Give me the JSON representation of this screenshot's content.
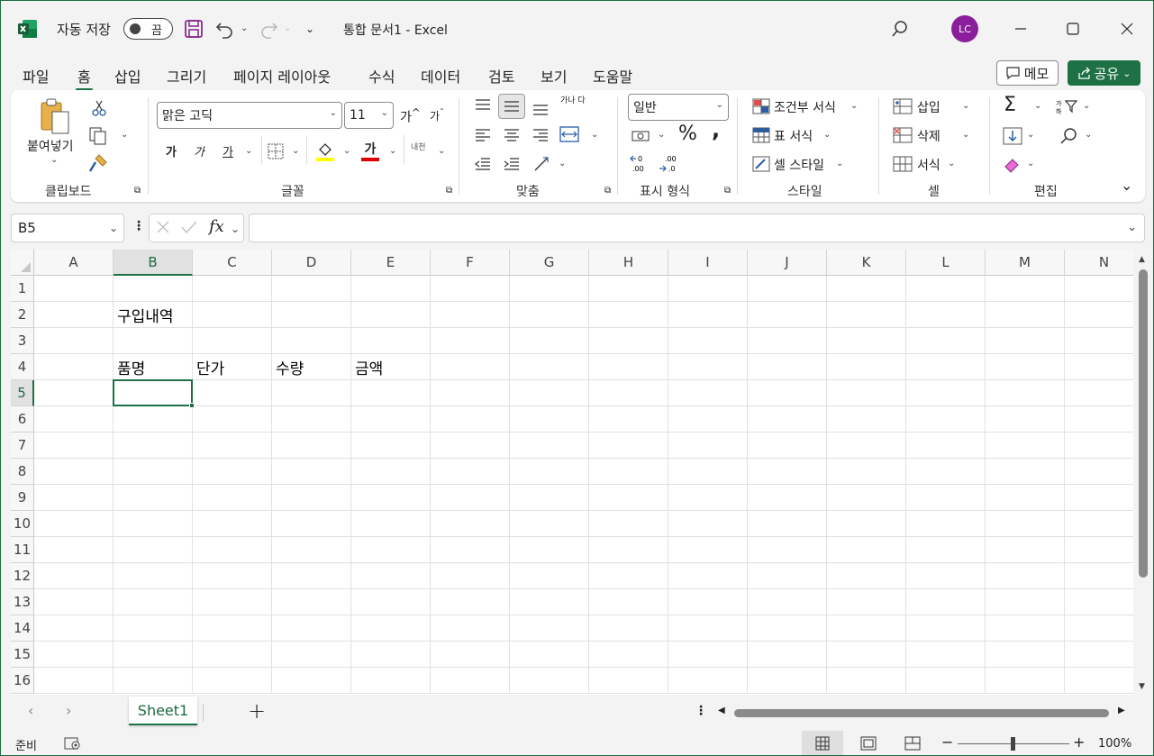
{
  "titlebar": {
    "app_icon": "excel-logo-icon",
    "autosave_label": "자동 저장",
    "autosave_state": "끔",
    "doc_title": "통합 문서1  -  Excel",
    "avatar_initials": "LC",
    "accent_color": "#1e7145",
    "avatar_color": "#8a1e9b"
  },
  "menu": {
    "items": [
      "파일",
      "홈",
      "삽입",
      "그리기",
      "페이지 레이아웃",
      "수식",
      "데이터",
      "검토",
      "보기",
      "도움말"
    ],
    "active": "홈",
    "memo_label": "메모",
    "share_label": "공유"
  },
  "ribbon": {
    "clipboard": {
      "paste_label": "붙여넣기",
      "group_label": "클립보드"
    },
    "font": {
      "font_name": "맑은 고딕",
      "font_size": "11",
      "group_label": "글꼴",
      "bold": "가",
      "italic": "가",
      "underline": "가",
      "grow": "가",
      "shrink": "가",
      "font_color_glyph": "가",
      "phonetic": "내천"
    },
    "alignment": {
      "group_label": "맞춤",
      "wrap": "가나 다"
    },
    "number": {
      "format": "일반",
      "group_label": "표시 형식",
      "percent": "%",
      "comma": ","
    },
    "styles": {
      "conditional": "조건부 서식",
      "table": "표 서식",
      "cell": "셀 스타일",
      "group_label": "스타일"
    },
    "cells": {
      "insert": "삽입",
      "delete": "삭제",
      "format": "서식",
      "group_label": "셀"
    },
    "editing": {
      "group_label": "편집"
    }
  },
  "formula_bar": {
    "name_box": "B5",
    "fx": "fx",
    "formula": ""
  },
  "grid": {
    "columns": [
      "A",
      "B",
      "C",
      "D",
      "E",
      "F",
      "G",
      "H",
      "I",
      "J",
      "K",
      "L",
      "M",
      "N"
    ],
    "rows": [
      "1",
      "2",
      "3",
      "4",
      "5",
      "6",
      "7",
      "8",
      "9",
      "10",
      "11",
      "12",
      "13",
      "14",
      "15",
      "16"
    ],
    "selected_cell": "B5",
    "cells": {
      "B2": "구입내역",
      "B4": "품명",
      "C4": "단가",
      "D4": "수량",
      "E4": "금액"
    }
  },
  "sheets": {
    "tabs": [
      "Sheet1"
    ],
    "active": "Sheet1"
  },
  "status": {
    "ready": "준비",
    "zoom": "100%"
  }
}
